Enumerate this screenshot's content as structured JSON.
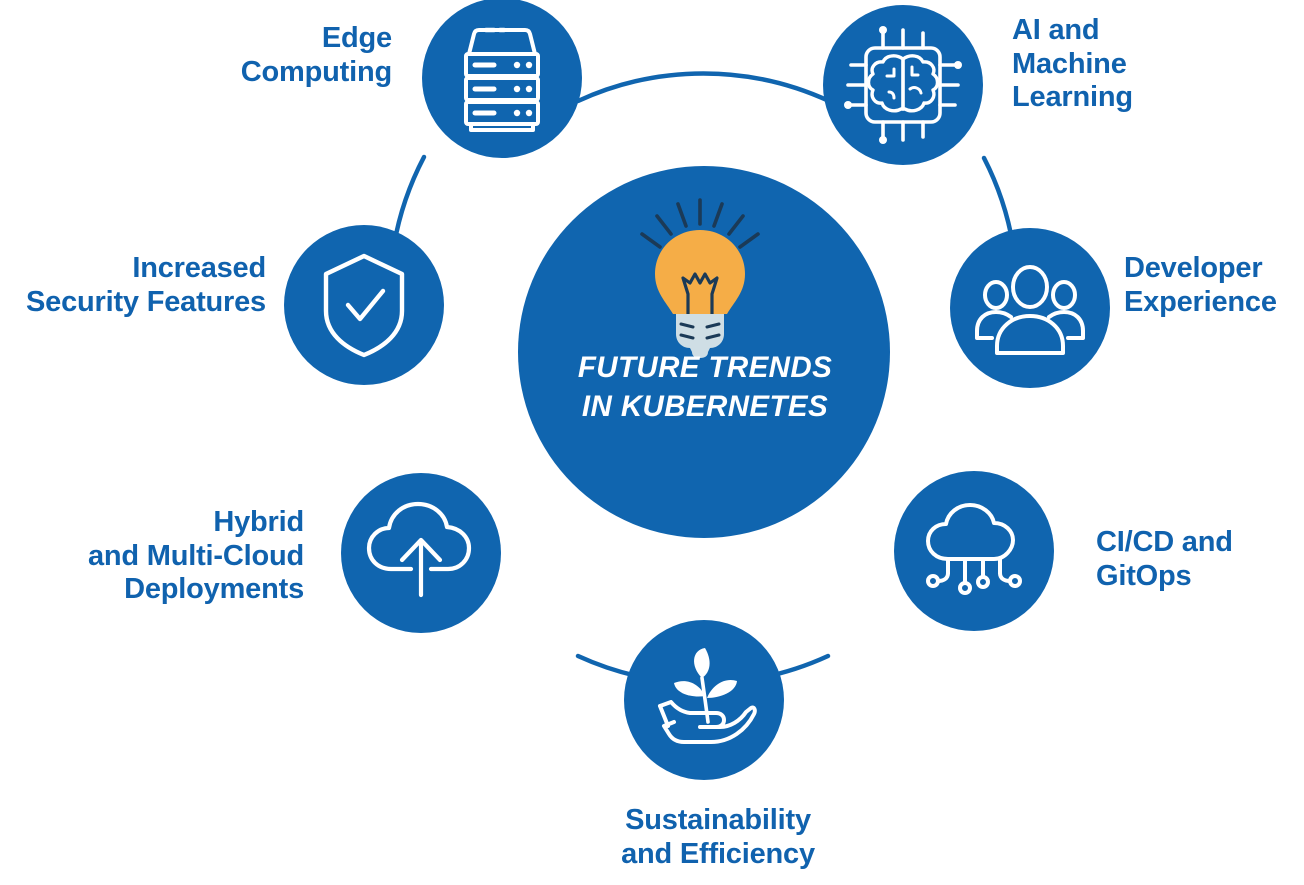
{
  "diagram": {
    "title_lines": "FUTURE TRENDS\nIN KUBERNETES",
    "center_icon": "lightbulb-icon",
    "colors": {
      "primary_blue": "#1065AF",
      "text_blue": "#1062AE",
      "ring_line": "#1065AF",
      "icon_white": "#FFFFFF",
      "bulb_orange": "#F5AD47",
      "bulb_base_gray": "#CFDEE5",
      "bulb_outline_navy": "#1B3A57",
      "background": "#FFFFFF"
    },
    "nodes": [
      {
        "id": "edge-computing",
        "label": "Edge\nComputing",
        "icon": "server-rack-icon",
        "label_align": "right"
      },
      {
        "id": "ai-machine-learning",
        "label": "AI and\nMachine\nLearning",
        "icon": "chip-brain-icon",
        "label_align": "left"
      },
      {
        "id": "developer-experience",
        "label": "Developer\nExperience",
        "icon": "people-group-icon",
        "label_align": "left"
      },
      {
        "id": "cicd-gitops",
        "label": "CI/CD and\nGitOps",
        "icon": "cloud-network-icon",
        "label_align": "left"
      },
      {
        "id": "sustainability-efficiency",
        "label": "Sustainability\nand Efficiency",
        "icon": "hand-plant-icon",
        "label_align": "center"
      },
      {
        "id": "hybrid-multicloud",
        "label": "Hybrid\nand Multi-Cloud\nDeployments",
        "icon": "cloud-upload-icon",
        "label_align": "right"
      },
      {
        "id": "increased-security",
        "label": "Increased\nSecurity Features",
        "icon": "shield-check-icon",
        "label_align": "right"
      }
    ]
  }
}
